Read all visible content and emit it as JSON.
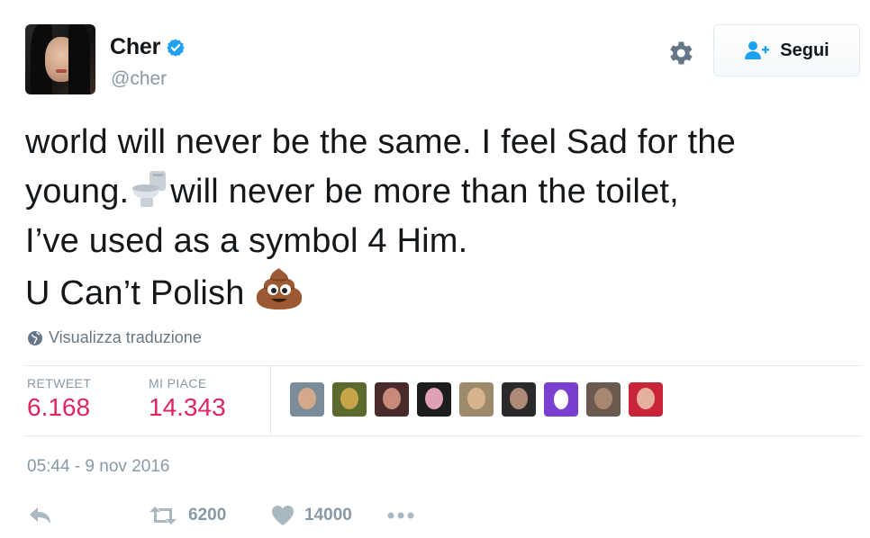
{
  "header": {
    "display_name": "Cher",
    "handle": "@cher",
    "follow_label": "Segui"
  },
  "tweet": {
    "lines": [
      "world will never be the same. I feel Sad for the",
      "young.",
      "will never be more than the toilet,",
      "I’ve used as a symbol 4 Him.",
      "U Can’t Polish"
    ],
    "emojis": [
      "toilet-emoji",
      "pile-of-poo-emoji"
    ],
    "translate_label": "Visualizza traduzione"
  },
  "stats": {
    "retweet_label": "RETWEET",
    "retweet_count": "6.168",
    "like_label": "MI PIACE",
    "like_count": "14.343"
  },
  "timestamp": "05:44 - 9 nov 2016",
  "actions": {
    "retweet_count": "6200",
    "like_count": "14000"
  },
  "colors": {
    "accent_blue": "#1da1f2",
    "like_red": "#e0245e",
    "muted": "#8899a6"
  },
  "icons": [
    "verified-badge-icon",
    "gear-icon",
    "follow-person-icon",
    "globe-icon",
    "reply-icon",
    "retweet-icon",
    "heart-icon",
    "more-icon"
  ]
}
